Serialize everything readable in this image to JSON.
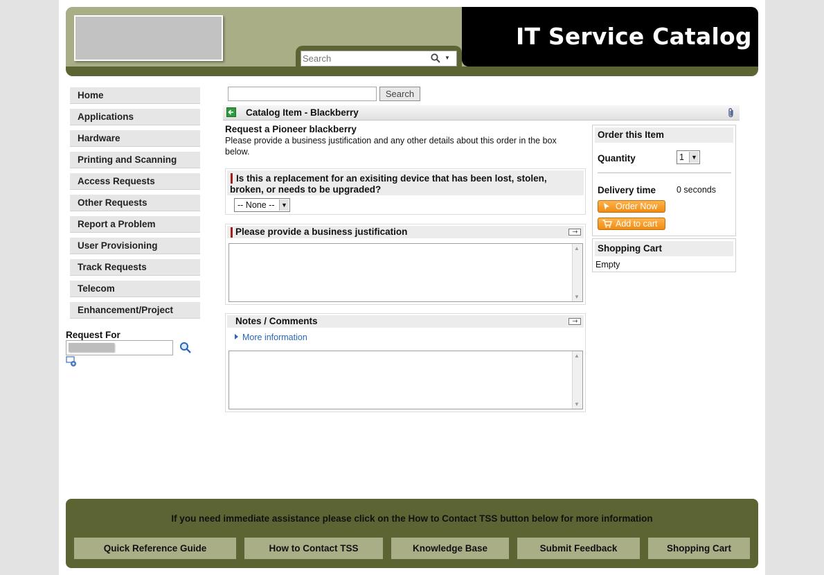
{
  "header": {
    "title": "IT Service Catalog",
    "search_placeholder": "Search"
  },
  "sidebar": {
    "items": [
      {
        "label": "Home"
      },
      {
        "label": "Applications"
      },
      {
        "label": "Hardware"
      },
      {
        "label": "Printing and Scanning"
      },
      {
        "label": "Access Requests"
      },
      {
        "label": "Other Requests"
      },
      {
        "label": "Report a Problem"
      },
      {
        "label": "User Provisioning"
      },
      {
        "label": "Track Requests"
      },
      {
        "label": "Telecom"
      },
      {
        "label": "Enhancement/Project"
      }
    ],
    "request_for_label": "Request For"
  },
  "main": {
    "search_button": "Search",
    "catalog_title": "Catalog Item - Blackberry",
    "item_title": "Request a Pioneer blackberry",
    "item_description": "Please provide a business justification and any other details about this order in the box below.",
    "question": "Is this a replacement for an exisiting device that has been lost, stolen, broken, or needs to be upgraded?",
    "question_value": "-- None --",
    "justification_label": "Please provide a business justification",
    "notes_label": "Notes / Comments",
    "more_info": "More information"
  },
  "order": {
    "title": "Order this Item",
    "quantity_label": "Quantity",
    "quantity_value": "1",
    "delivery_label": "Delivery time",
    "delivery_value": "0 seconds",
    "order_now": "Order Now",
    "add_to_cart": "Add to cart"
  },
  "cart": {
    "title": "Shopping Cart",
    "status": "Empty"
  },
  "footer": {
    "message": "If you need immediate assistance please click on the How to Contact TSS button below for more information",
    "buttons": [
      {
        "label": "Quick Reference Guide"
      },
      {
        "label": "How to Contact TSS"
      },
      {
        "label": "Knowledge Base"
      },
      {
        "label": "Submit Feedback"
      },
      {
        "label": "Shopping Cart"
      }
    ]
  },
  "colors": {
    "header_dark": "#5c6434",
    "header_light": "#a9ae87",
    "link_blue": "#2a66b7",
    "order_button": "#f08c12",
    "required_marker": "#a31f1f"
  }
}
